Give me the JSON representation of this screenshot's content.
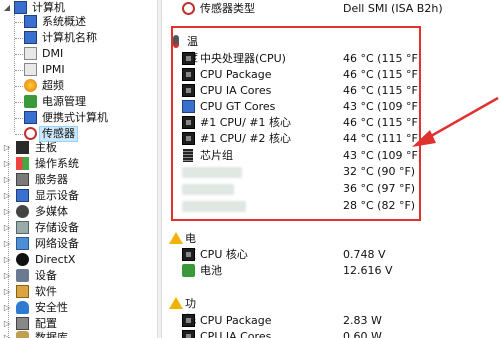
{
  "tree": {
    "computer": "计算机",
    "computer_children": [
      "系统概述",
      "计算机名称",
      "DMI",
      "IPMI",
      "超频",
      "电源管理",
      "便携式计算机",
      "传感器"
    ],
    "categories": [
      "主板",
      "操作系统",
      "服务器",
      "显示设备",
      "多媒体",
      "存储设备",
      "网络设备",
      "DirectX",
      "设备",
      "软件",
      "安全性",
      "配置",
      "数据库"
    ]
  },
  "detail": {
    "sensor_type_label": "传感器类型",
    "sensor_type_value": "Dell SMI  (ISA B2h)",
    "temperature": {
      "title": "温度",
      "rows": [
        {
          "name": "中央处理器(CPU)",
          "value": "46 °C  (115 °F)",
          "icon": "chip-icon"
        },
        {
          "name": "CPU Package",
          "value": "46 °C  (115 °F)",
          "icon": "chip-icon"
        },
        {
          "name": "CPU IA Cores",
          "value": "46 °C  (115 °F)",
          "icon": "chip-icon"
        },
        {
          "name": "CPU GT Cores",
          "value": "43 °C  (109 °F)",
          "icon": "gpu-icon"
        },
        {
          "name": "#1 CPU/ #1 核心",
          "value": "46 °C  (115 °F)",
          "icon": "chip-icon"
        },
        {
          "name": "#1 CPU/ #2 核心",
          "value": "44 °C  (111 °F)",
          "icon": "chip-icon"
        },
        {
          "name": "芯片组",
          "value": "43 °C  (109 °F)",
          "icon": "chipset-icon"
        },
        {
          "name": "",
          "value": "32 °C  (90 °F)",
          "icon": "blurred"
        },
        {
          "name": "",
          "value": "36 °C  (97 °F)",
          "icon": "blurred"
        },
        {
          "name": "",
          "value": "28 °C  (82 °F)",
          "icon": "blurred"
        }
      ]
    },
    "voltage": {
      "title": "电压",
      "rows": [
        {
          "name": "CPU 核心",
          "value": "0.748 V"
        },
        {
          "name": "电池",
          "value": "12.616 V"
        }
      ]
    },
    "power": {
      "title": "功耗",
      "rows": [
        {
          "name": "CPU Package",
          "value": "2.83 W"
        },
        {
          "name": "CPU IA Cores",
          "value": "0.60 W"
        }
      ]
    }
  },
  "colors": {
    "highlight": "#e0302f",
    "selection": "#cce8ff"
  }
}
